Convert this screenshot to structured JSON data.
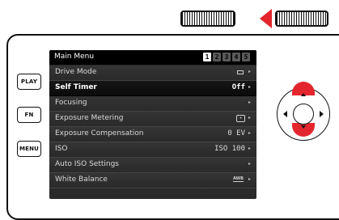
{
  "controls": {
    "play_label": "PLAY",
    "fn_label": "FN",
    "menu_label": "MENU"
  },
  "screen": {
    "title": "Main Menu",
    "pages": [
      "1",
      "2",
      "3",
      "4",
      "5"
    ],
    "active_page": "1",
    "items": [
      {
        "label": "Drive Mode",
        "value": "",
        "value_icon": "single-shot-icon",
        "selected": false
      },
      {
        "label": "Self Timer",
        "value": "Off",
        "value_icon": "",
        "selected": true
      },
      {
        "label": "Focusing",
        "value": "",
        "value_icon": "",
        "selected": false
      },
      {
        "label": "Exposure Metering",
        "value": "",
        "value_icon": "metering-mode-icon",
        "selected": false
      },
      {
        "label": "Exposure Compensation",
        "value": "0 EV",
        "value_icon": "",
        "selected": false
      },
      {
        "label": "ISO",
        "value": "ISO 100",
        "value_icon": "",
        "selected": false
      },
      {
        "label": "Auto ISO Settings",
        "value": "",
        "value_icon": "",
        "selected": false
      },
      {
        "label": "White Balance",
        "value": "",
        "value_icon": "auto-white-balance-icon",
        "selected": false
      }
    ]
  },
  "colors": {
    "accent_red": "#e3262d",
    "screen_bg": "#2a2a2a",
    "selected_row_bg": "#0b0b0b"
  },
  "icons": {
    "left_thumbwheel": "thumbwheel-icon",
    "right_thumbwheel": "thumbwheel-icon",
    "wheel_direction": "left-triangle-arrow-icon",
    "dpad": "direction-pad-icon"
  }
}
